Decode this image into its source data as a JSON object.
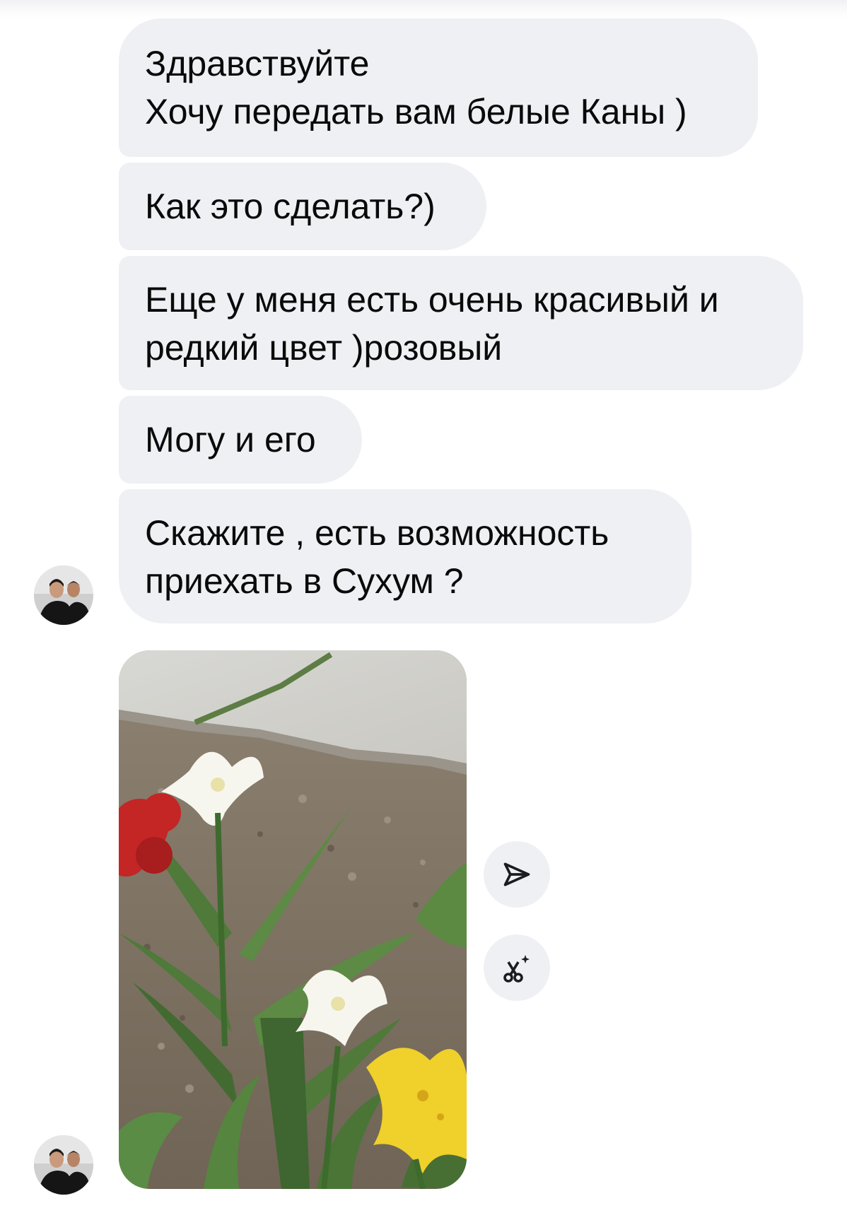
{
  "messages": [
    {
      "lines": [
        "Здравствуйте",
        "Хочу передать вам белые Каны )"
      ]
    },
    {
      "lines": [
        "Как это сделать?)"
      ]
    },
    {
      "lines": [
        "Еще у меня есть очень красивый и",
        "редкий цвет )розовый"
      ]
    },
    {
      "lines": [
        "Могу и его"
      ]
    },
    {
      "lines": [
        "Скажите , есть возможность",
        "приехать в Сухум ?"
      ]
    }
  ],
  "photo_message": {
    "icon": "flower-photo"
  },
  "actions": {
    "share_icon": "send-icon",
    "ai_icon": "sparkle-scissors-icon"
  },
  "colors": {
    "bubble": "#eff0f3",
    "text": "#0a0a0a",
    "icon": "#1c1c1e"
  }
}
